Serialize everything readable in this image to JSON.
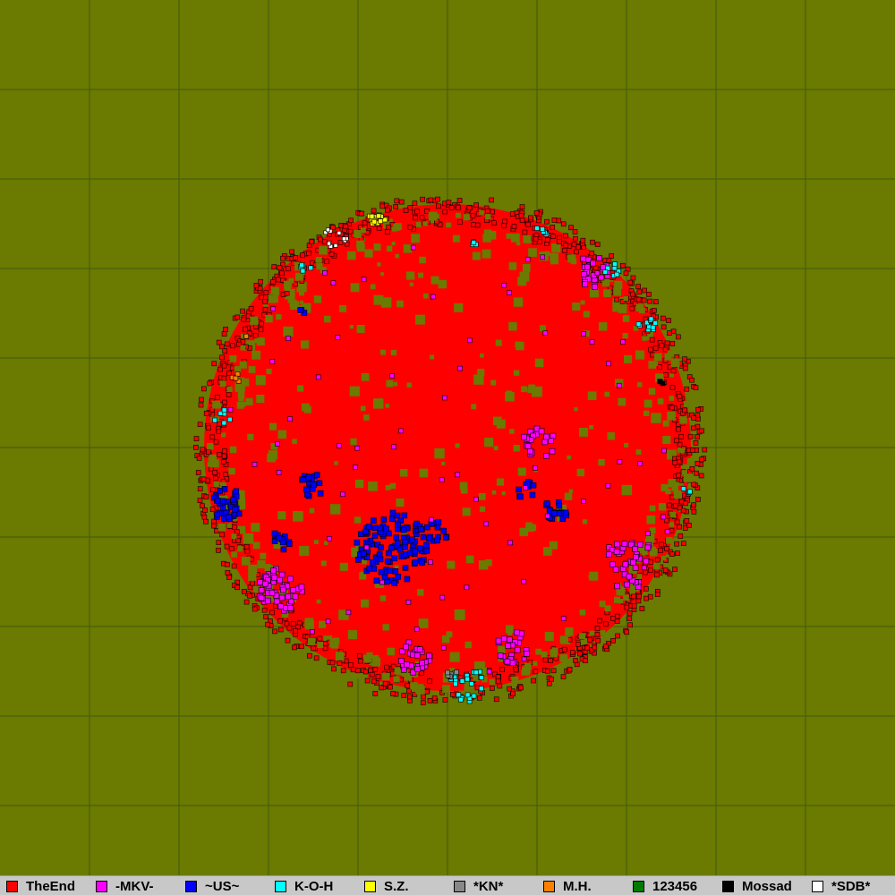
{
  "map": {
    "background_color": "#6b7a00",
    "grid_color": "#3f5a10",
    "primary_tribe_color": "#ff0000"
  },
  "legend": {
    "items": [
      {
        "name": "TheEnd",
        "color": "#ff0000"
      },
      {
        "name": "-MKV-",
        "color": "#ff00ff"
      },
      {
        "name": "~US~",
        "color": "#0000ff"
      },
      {
        "name": "K-O-H",
        "color": "#00ffff"
      },
      {
        "name": "S.Z.",
        "color": "#ffff00"
      },
      {
        "name": "*KN*",
        "color": "#888888"
      },
      {
        "name": "M.H.",
        "color": "#ff8000"
      },
      {
        "name": "123456",
        "color": "#007a00"
      },
      {
        "name": "Mossad",
        "color": "#000000"
      },
      {
        "name": "*SDB*",
        "color": "#ffffff"
      }
    ]
  }
}
